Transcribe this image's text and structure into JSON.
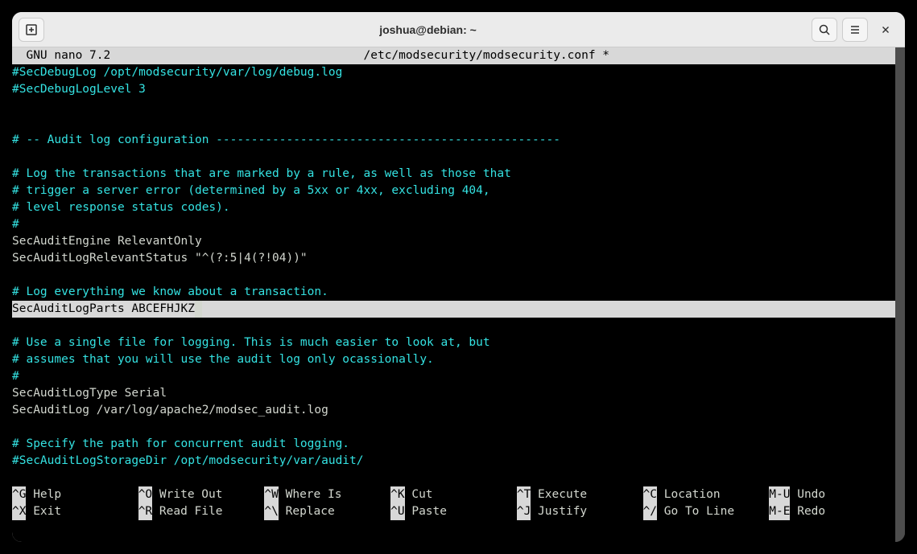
{
  "window": {
    "title": "joshua@debian: ~"
  },
  "editor": {
    "app_version": "  GNU nano 7.2",
    "filename": "/etc/modsecurity/modsecurity.conf *"
  },
  "lines": {
    "l1": "#SecDebugLog /opt/modsecurity/var/log/debug.log",
    "l2": "#SecDebugLogLevel 3",
    "l3": "# -- Audit log configuration -------------------------------------------------",
    "l4": "# Log the transactions that are marked by a rule, as well as those that",
    "l5": "# trigger a server error (determined by a 5xx or 4xx, excluding 404,",
    "l6": "# level response status codes).",
    "l7": "#",
    "l8": "SecAuditEngine RelevantOnly",
    "l9": "SecAuditLogRelevantStatus \"^(?:5|4(?!04))\"",
    "l10": "# Log everything we know about a transaction.",
    "l11": "SecAuditLogParts ABCEFHJKZ",
    "l12": "# Use a single file for logging. This is much easier to look at, but",
    "l13": "# assumes that you will use the audit log only ocassionally.",
    "l14": "#",
    "l15": "SecAuditLogType Serial",
    "l16": "SecAuditLog /var/log/apache2/modsec_audit.log",
    "l17": "# Specify the path for concurrent audit logging.",
    "l18": "#SecAuditLogStorageDir /opt/modsecurity/var/audit/"
  },
  "shortcuts": [
    {
      "key": "^G",
      "label": " Help"
    },
    {
      "key": "^O",
      "label": " Write Out"
    },
    {
      "key": "^W",
      "label": " Where Is"
    },
    {
      "key": "^K",
      "label": " Cut"
    },
    {
      "key": "^T",
      "label": " Execute"
    },
    {
      "key": "^C",
      "label": " Location"
    },
    {
      "key": "M-U",
      "label": " Undo"
    },
    {
      "key": "^X",
      "label": " Exit"
    },
    {
      "key": "^R",
      "label": " Read File"
    },
    {
      "key": "^\\",
      "label": " Replace"
    },
    {
      "key": "^U",
      "label": " Paste"
    },
    {
      "key": "^J",
      "label": " Justify"
    },
    {
      "key": "^/",
      "label": " Go To Line"
    },
    {
      "key": "M-E",
      "label": " Redo"
    }
  ]
}
